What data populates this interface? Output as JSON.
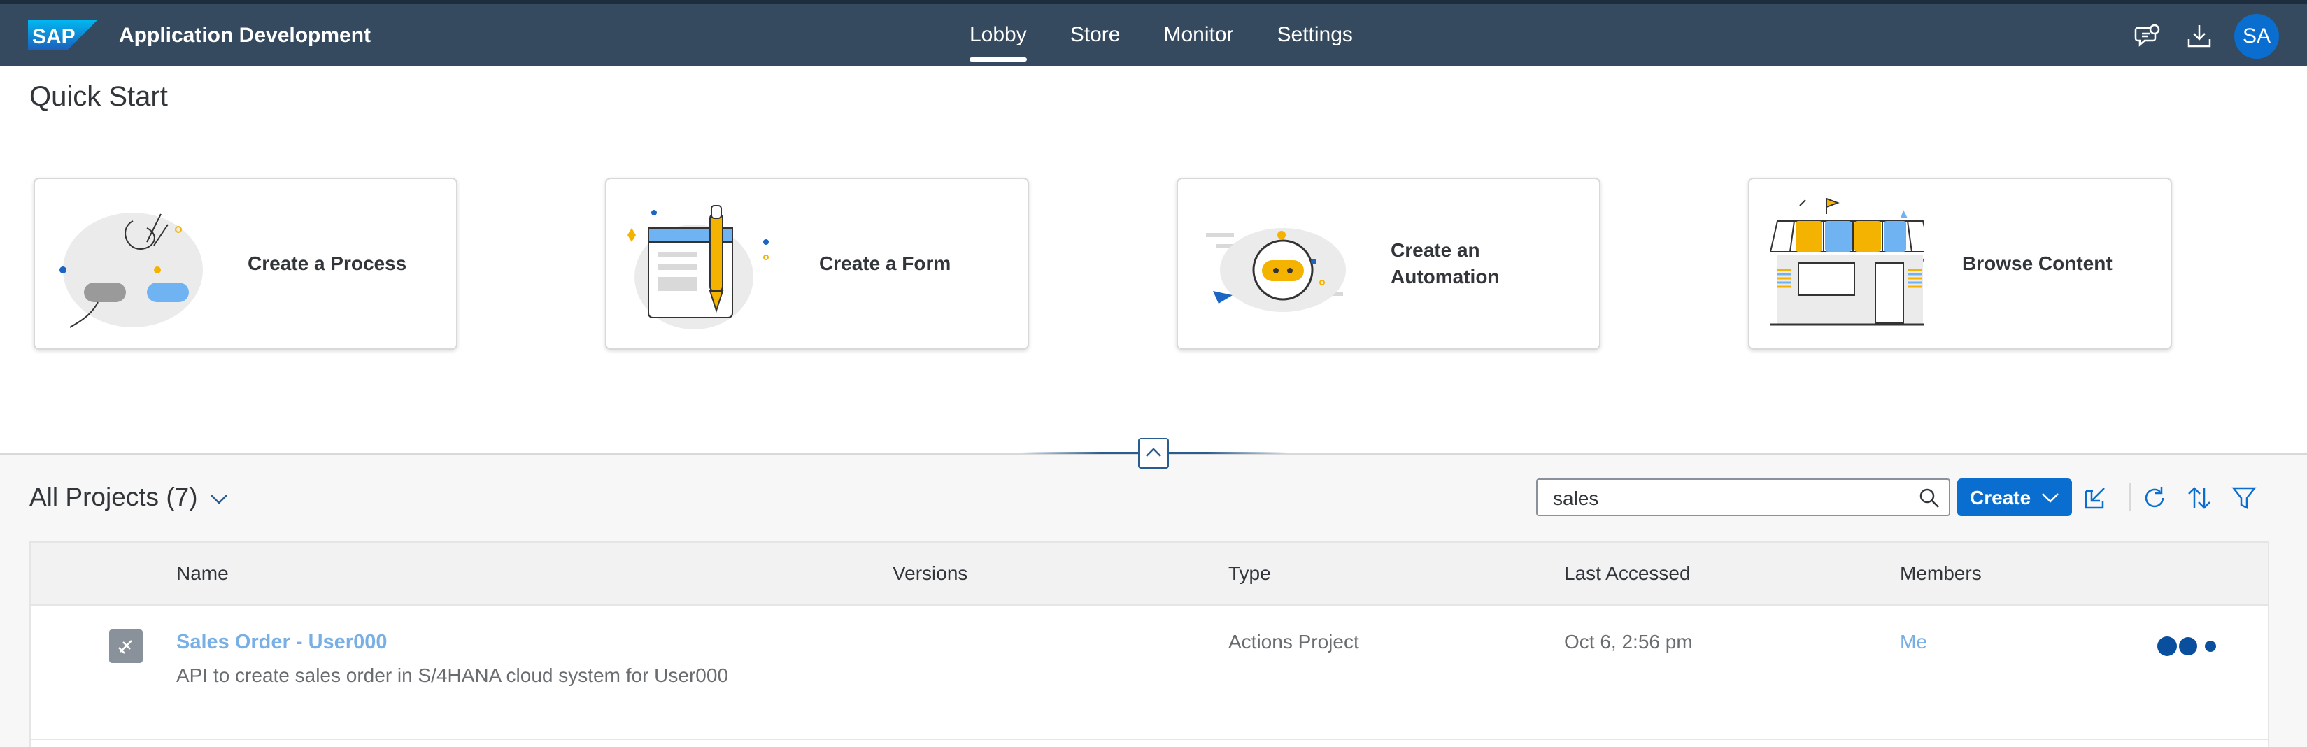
{
  "shell": {
    "logo_text": "SAP",
    "app_title": "Application Development",
    "nav": [
      {
        "label": "Lobby",
        "active": true
      },
      {
        "label": "Store",
        "active": false
      },
      {
        "label": "Monitor",
        "active": false
      },
      {
        "label": "Settings",
        "active": false
      }
    ],
    "icons": [
      "feedback-icon",
      "download-icon"
    ],
    "avatar_initials": "SA"
  },
  "quick_start": {
    "title": "Quick Start",
    "cards": [
      {
        "label": "Create a Process",
        "icon": "process-illustration"
      },
      {
        "label": "Create a Form",
        "icon": "form-illustration"
      },
      {
        "label": "Create an Automation",
        "icon": "automation-illustration"
      },
      {
        "label": "Browse Content",
        "icon": "store-illustration"
      }
    ]
  },
  "projects": {
    "title": "All Projects (7)",
    "search_value": "sales",
    "create_label": "Create",
    "toolbar_icons": [
      "import-icon",
      "refresh-icon",
      "sort-icon",
      "filter-icon"
    ],
    "columns": [
      "Name",
      "Versions",
      "Type",
      "Last Accessed",
      "Members"
    ],
    "rows": [
      {
        "name": "Sales Order - User000",
        "description": "API to create sales order in S/4HANA cloud system for User000",
        "versions": "",
        "type": "Actions Project",
        "last_accessed": "Oct 6, 2:56 pm",
        "members": "Me"
      }
    ]
  },
  "colors": {
    "shell_bg": "#354a5f",
    "accent": "#0a6ed1",
    "illustration_yellow": "#f5b301",
    "illustration_blue": "#6fb3f3"
  }
}
